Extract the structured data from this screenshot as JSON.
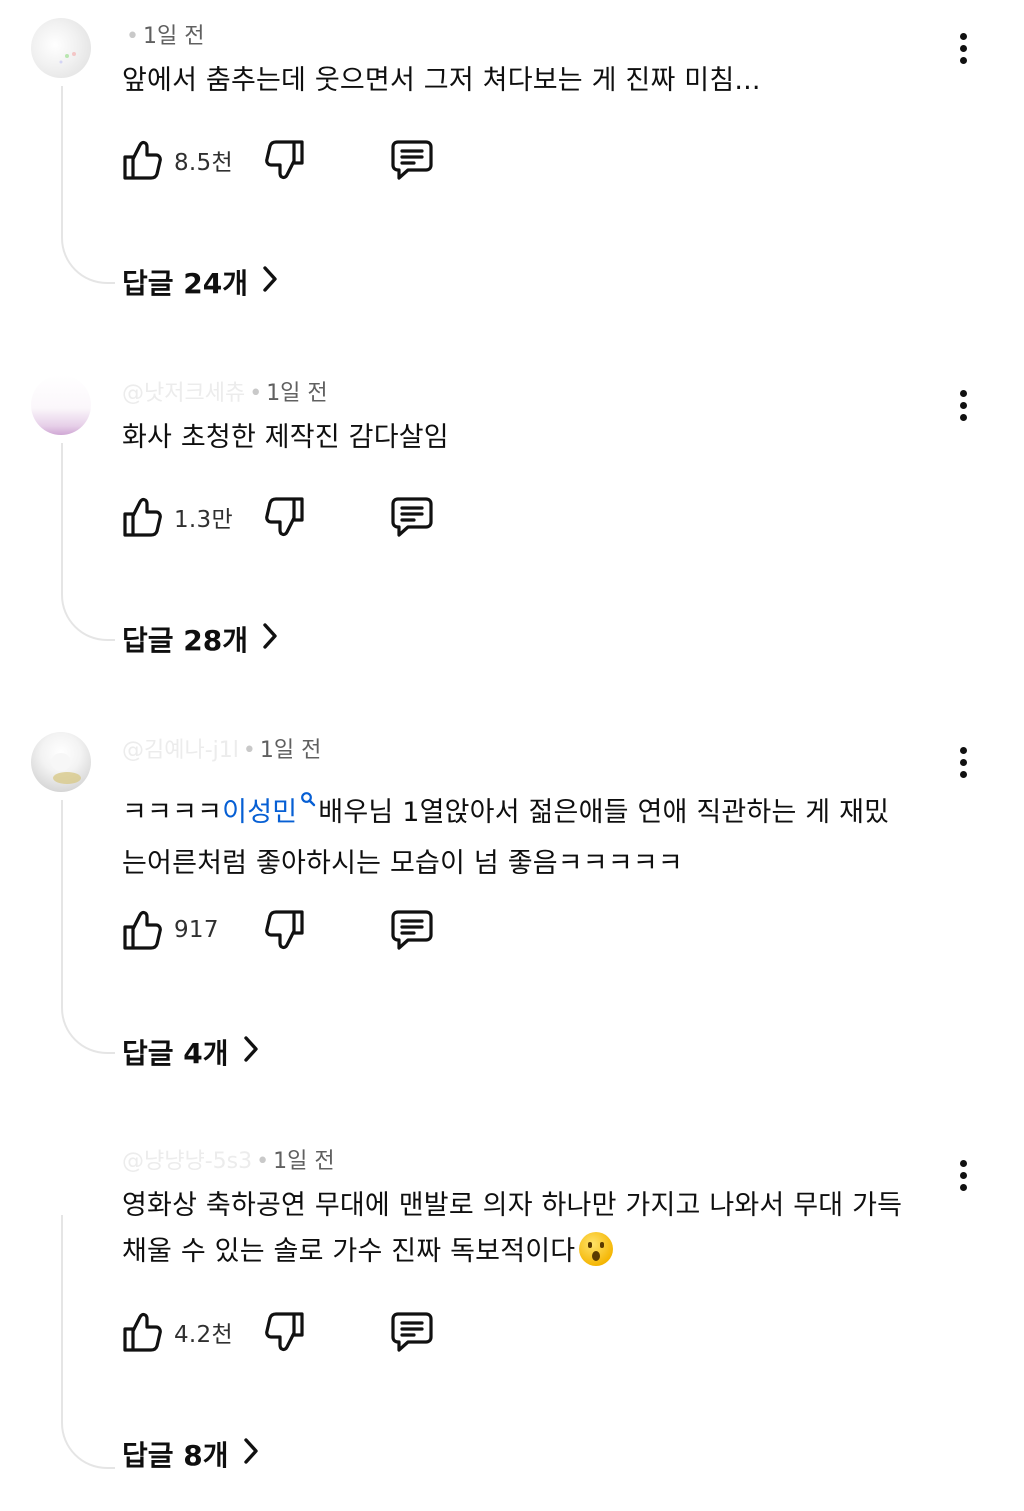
{
  "comments": [
    {
      "handle": "",
      "time": "1일 전",
      "text": "앞에서 춤추는데 웃으면서 그저 쳐다보는 게 진짜 미침...",
      "likes": "8.5천",
      "replies": "답글 24개"
    },
    {
      "handle": "@낫저크세츄",
      "time": "1일 전",
      "text": "화사 초청한 제작진 감다살임",
      "likes": "1.3만",
      "replies": "답글 28개"
    },
    {
      "handle": "@김예나-j1l",
      "time": "1일 전",
      "text_prefix": "ㅋㅋㅋㅋ",
      "mention": "이성민",
      "text_line1_rest": "배우님 1열앉아서 젊은애들 연애 직관하는 게 재밌",
      "text_line2": "는어른처럼 좋아하시는 모습이 넘 좋음ㅋㅋㅋㅋㅋ",
      "likes": "917",
      "replies": "답글 4개"
    },
    {
      "handle": "@냥냥냥-5s3",
      "time": "1일 전",
      "text_line1": "영화상 축하공연 무대에 맨발로 의자 하나만 가지고 나와서 무대 가득",
      "text_line2": "채울 수 있는 솔로 가수 진짜 독보적이다",
      "likes": "4.2천",
      "replies": "답글 8개"
    }
  ],
  "icons": {
    "like": "thumbs-up-icon",
    "dislike": "thumbs-down-icon",
    "reply": "comment-icon",
    "more": "more-vert-icon",
    "chevron": "chevron-right-icon",
    "mention": "search-icon",
    "emoji": "surprised-face-emoji"
  },
  "colors": {
    "text": "#0f0f0f",
    "meta": "#606060",
    "mention": "#065fd4",
    "thread_line": "#e5e5e5"
  }
}
